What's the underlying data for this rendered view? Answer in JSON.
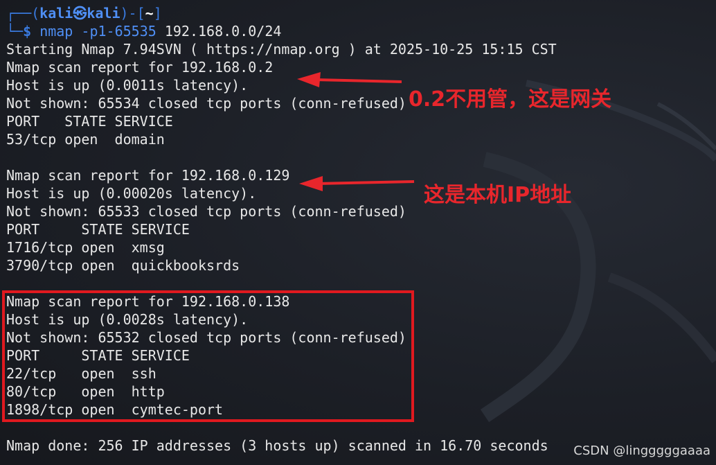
{
  "prompt": {
    "frame_top_left": "┌──(",
    "user": "kali",
    "at_symbol": "㉿",
    "host": "kali",
    "frame_mid": ")-[",
    "dir": "~",
    "frame_end": "]",
    "frame_bottom": "└─",
    "dollar": "$",
    "command": "nmap",
    "flag": " -p1-65535",
    "target": " 192.168.0.0/24"
  },
  "output_lines": [
    "Starting Nmap 7.94SVN ( https://nmap.org ) at 2025-10-25 15:15 CST",
    "Nmap scan report for 192.168.0.2",
    "Host is up (0.0011s latency).",
    "Not shown: 65534 closed tcp ports (conn-refused)",
    "PORT   STATE SERVICE",
    "53/tcp open  domain",
    "",
    "Nmap scan report for 192.168.0.129",
    "Host is up (0.00020s latency).",
    "Not shown: 65533 closed tcp ports (conn-refused)",
    "PORT     STATE SERVICE",
    "1716/tcp open  xmsg",
    "3790/tcp open  quickbooksrds",
    "",
    "Nmap scan report for 192.168.0.138",
    "Host is up (0.0028s latency).",
    "Not shown: 65532 closed tcp ports (conn-refused)",
    "PORT     STATE SERVICE",
    "22/tcp   open  ssh",
    "80/tcp   open  http",
    "1898/tcp open  cymtec-port",
    "",
    "Nmap done: 256 IP addresses (3 hosts up) scanned in 16.70 seconds"
  ],
  "annotations": {
    "gateway_note": "0.2不用管，这是网关",
    "local_ip_note": "这是本机IP地址"
  },
  "watermark": "CSDN @lingggggaaaa",
  "colors": {
    "annotation_red": "#e8262c",
    "prompt_blue": "#4f8ff5",
    "background": "#1e2129"
  }
}
